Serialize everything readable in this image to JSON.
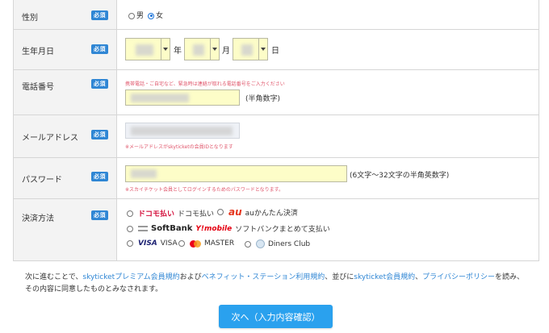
{
  "form": {
    "required_badge": "必須",
    "gender": {
      "label": "性別",
      "options": [
        "男",
        "女"
      ],
      "selected": "女"
    },
    "birthdate": {
      "label": "生年月日",
      "year_unit": "年",
      "month_unit": "月",
      "day_unit": "日"
    },
    "phone": {
      "label": "電話番号",
      "note": "携帯電話・ご自宅など、緊急時は連絡が取れる電話番号をご入力ください",
      "hint": "(半角数字)"
    },
    "email": {
      "label": "メールアドレス",
      "note": "※メールアドレスがskyticketの会員IDとなります"
    },
    "password": {
      "label": "パスワード",
      "note": "※スカイチケット会員としてログインするためのパスワードとなります。",
      "hint": "(6文字～32文字の半角英数字)"
    },
    "payment": {
      "label": "決済方法",
      "docomo_logo": "ドコモ払い",
      "docomo_label": "ドコモ払い",
      "au_logo": "au",
      "au_label": "auかんたん決済",
      "softbank_logo": "SoftBank",
      "ymobile_logo": "Y!mobile",
      "softbank_label": "ソフトバンクまとめて支払い",
      "visa_logo": "VISA",
      "visa_label": "VISA",
      "master_label": "MASTER",
      "diners_label": "Diners Club"
    }
  },
  "consent": {
    "t1": "次に進むことで、",
    "link1": "skyticketプレミアム会員規約",
    "t2": "および",
    "link2": "ベネフィット・ステーション利用規約",
    "t3": "、並びに",
    "link3": "skyticket会員規約",
    "t4": "、",
    "link4": "プライバシーポリシー",
    "t5": "を読み、その内容に同意したものとみなされます。"
  },
  "next_button": "次へ（入力内容確認）",
  "colors": {
    "accent": "#2f86d4",
    "button": "#2aa1ee",
    "input_bg": "#fdfdc8",
    "note_red": "#e0566b"
  }
}
